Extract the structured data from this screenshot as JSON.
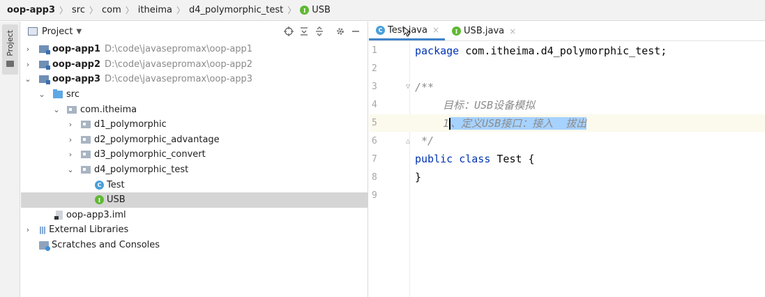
{
  "breadcrumb": {
    "items": [
      "oop-app3",
      "src",
      "com",
      "itheima",
      "d4_polymorphic_test",
      "USB"
    ],
    "iface_badge": "I"
  },
  "tool_strip": {
    "project_label": "Project"
  },
  "project_panel": {
    "title": "Project",
    "tree": [
      {
        "label": "oop-app1",
        "path": "D:\\code\\javasepromax\\oop-app1"
      },
      {
        "label": "oop-app2",
        "path": "D:\\code\\javasepromax\\oop-app2"
      },
      {
        "label": "oop-app3",
        "path": "D:\\code\\javasepromax\\oop-app3"
      },
      {
        "label": "src"
      },
      {
        "label": "com.itheima"
      },
      {
        "label": "d1_polymorphic"
      },
      {
        "label": "d2_polymorphic_advantage"
      },
      {
        "label": "d3_polymorphic_convert"
      },
      {
        "label": "d4_polymorphic_test"
      },
      {
        "label": "Test",
        "badge": "C"
      },
      {
        "label": "USB",
        "badge": "I"
      },
      {
        "label": "oop-app3.iml"
      },
      {
        "label": "External Libraries"
      },
      {
        "label": "Scratches and Consoles"
      }
    ]
  },
  "editor": {
    "tabs": [
      {
        "label": "Test.java",
        "badge": "C",
        "close": "×"
      },
      {
        "label": "USB.java",
        "badge": "I",
        "close": "×"
      }
    ],
    "lines": [
      {
        "n": "1",
        "kw": "package",
        "rest": " com.itheima.d4_polymorphic_test;"
      },
      {
        "n": "2"
      },
      {
        "n": "3",
        "comment": "/**"
      },
      {
        "n": "4",
        "comment": "目标：USB设备模拟"
      },
      {
        "n": "5",
        "sel_head": "1",
        "sel": "、定义USB接口：接入  拔出"
      },
      {
        "n": "6",
        "comment": " */"
      },
      {
        "n": "7",
        "kw": "public",
        "kw2": "class",
        "rest": " Test {"
      },
      {
        "n": "8",
        "rest": "}"
      },
      {
        "n": "9"
      }
    ]
  }
}
